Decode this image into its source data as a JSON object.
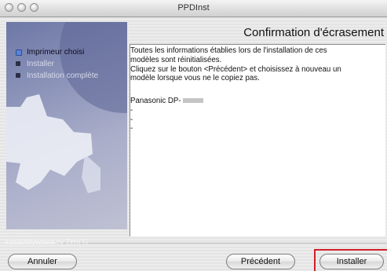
{
  "window": {
    "title": "PPDInst"
  },
  "header": {
    "title": "Confirmation d'écrasement"
  },
  "steps": [
    {
      "label": "Imprimeur choisi",
      "state": "current"
    },
    {
      "label": "Installer",
      "state": "pending"
    },
    {
      "label": "Installation complète",
      "state": "pending"
    }
  ],
  "content": {
    "lines": [
      "Toutes les informations établies lors de l'installation de ces",
      "modèles sont réinitialisées.",
      "Cliquez sur le bouton <Précédent> et choisissez à nouveau un",
      "modèle lorsque vous ne le copiez pas."
    ],
    "product": "Panasonic DP-",
    "dashes": [
      "-",
      "-",
      "-"
    ]
  },
  "footer": {
    "credit": "InstallAnywhere by Zero G",
    "cancel_label": "Annuler",
    "previous_label": "Précédent",
    "install_label": "Installer"
  },
  "colors": {
    "highlight": "#d0202a",
    "panel": "#8a92b8",
    "step_current": "#5a84d6"
  }
}
